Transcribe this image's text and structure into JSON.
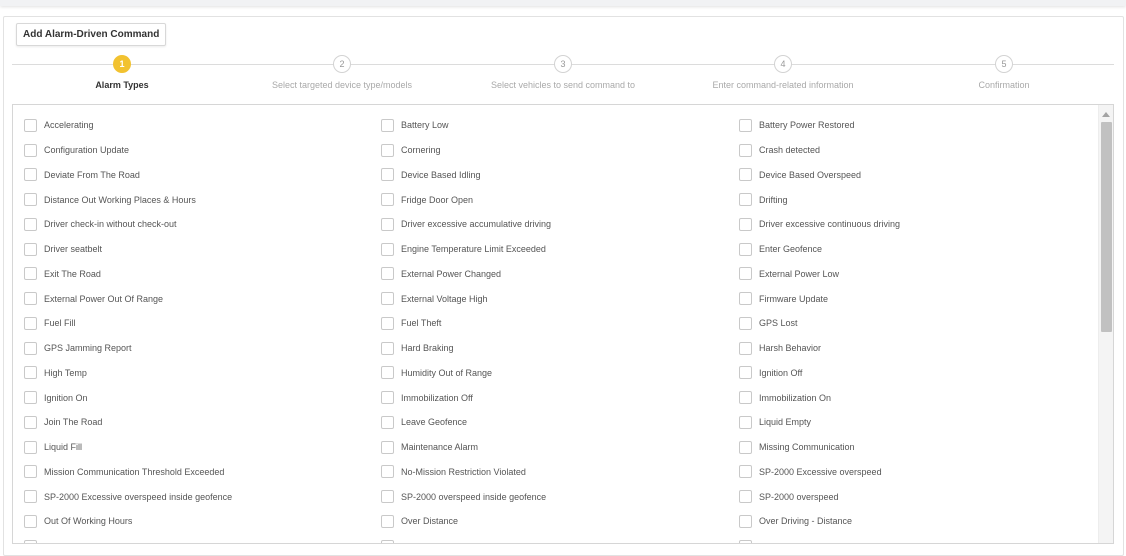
{
  "panel": {
    "title": "Add Alarm-Driven Command"
  },
  "steps": [
    {
      "number": "1",
      "label": "Alarm Types",
      "active": true
    },
    {
      "number": "2",
      "label": "Select targeted device type/models",
      "active": false
    },
    {
      "number": "3",
      "label": "Select vehicles to send command to",
      "active": false
    },
    {
      "number": "4",
      "label": "Enter command-related information",
      "active": false
    },
    {
      "number": "5",
      "label": "Confirmation",
      "active": false
    }
  ],
  "alarm_types": [
    "Accelerating",
    "Battery Low",
    "Battery Power Restored",
    "Configuration Update",
    "Cornering",
    "Crash detected",
    "Deviate From The Road",
    "Device Based Idling",
    "Device Based Overspeed",
    "Distance Out Working Places & Hours",
    "Fridge Door Open",
    "Drifting",
    "Driver check-in without check-out",
    "Driver excessive accumulative driving",
    "Driver excessive continuous driving",
    "Driver seatbelt",
    "Engine Temperature Limit Exceeded",
    "Enter Geofence",
    "Exit The Road",
    "External Power Changed",
    "External Power Low",
    "External Power Out Of Range",
    "External Voltage High",
    "Firmware Update",
    "Fuel Fill",
    "Fuel Theft",
    "GPS Lost",
    "GPS Jamming Report",
    "Hard Braking",
    "Harsh Behavior",
    "High Temp",
    "Humidity Out of Range",
    "Ignition Off",
    "Ignition On",
    "Immobilization Off",
    "Immobilization On",
    "Join The Road",
    "Leave Geofence",
    "Liquid Empty",
    "Liquid Fill",
    "Maintenance Alarm",
    "Missing Communication",
    "Mission Communication Threshold Exceeded",
    "No-Mission Restriction Violated",
    "SP-2000 Excessive overspeed",
    "SP-2000 Excessive overspeed inside geofence",
    "SP-2000 overspeed inside geofence",
    "SP-2000 overspeed",
    "Out Of Working Hours",
    "Over Distance",
    "Over Driving - Distance",
    "",
    "",
    ""
  ],
  "colors": {
    "active_step": "#f2c230",
    "border": "#d6d6d6",
    "scroll_thumb": "#c1c1c1"
  }
}
